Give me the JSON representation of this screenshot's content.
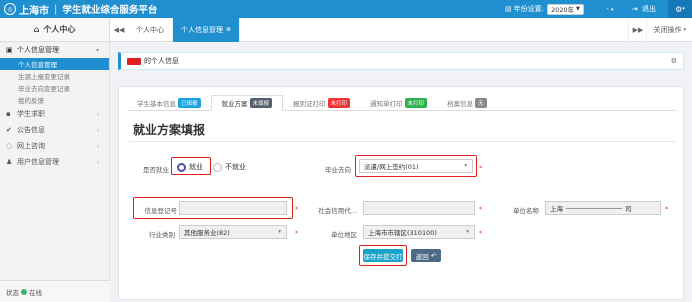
{
  "header": {
    "logo_text": "上海市",
    "app_title": "学生就业综合服务平台",
    "year_setting_label": "年份设置:",
    "year_value": "2020年",
    "user_menu": "-",
    "logout_label": "退出",
    "brand_color": "#1f8fd0"
  },
  "sidebar": {
    "title": "个人中心",
    "groups": [
      {
        "label": "个人信息管理",
        "icon": "user-card-icon",
        "items": [
          "个人信息管理",
          "生源上报变更记录",
          "毕业去向变更记录",
          "我的反馈"
        ]
      },
      {
        "label": "学生求职",
        "icon": "briefcase-icon"
      },
      {
        "label": "公告信息",
        "icon": "check-icon"
      },
      {
        "label": "网上咨询",
        "icon": "chat-icon"
      },
      {
        "label": "用户信息管理",
        "icon": "users-icon"
      }
    ],
    "status_label": "状态",
    "status_value": "在线"
  },
  "tabs": {
    "items": [
      "个人中心",
      "个人信息管理"
    ],
    "close_ops_label": "关闭操作"
  },
  "info": {
    "text": "的个人信息"
  },
  "form_tabs": [
    {
      "label": "学生基本信息",
      "badge": "已填报"
    },
    {
      "label": "就业方案",
      "badge": "未填报"
    },
    {
      "label": "报到证打印",
      "badge": "未打印"
    },
    {
      "label": "通知单打印",
      "badge": "未打印"
    },
    {
      "label": "档案信息",
      "badge": "无"
    }
  ],
  "form": {
    "title": "就业方案填报",
    "employed_label": "是否就业",
    "employed_yes": "就业",
    "employed_no": "不就业",
    "destination_label": "毕业去向",
    "destination_value": "派遣/网上签约(01)",
    "registration_label": "信息登记号",
    "registration_value": "",
    "credit_code_label": "社会信用代...",
    "credit_code_value": "",
    "unit_name_label": "单位名称",
    "unit_name_value": "上海",
    "unit_name_suffix": "司",
    "industry_label": "行业类别",
    "industry_value": "其他服务业(82)",
    "region_label": "单位地区",
    "region_value": "上海市市辖区(310100)",
    "save_label": "保存并提交打",
    "back_label": "返回"
  }
}
